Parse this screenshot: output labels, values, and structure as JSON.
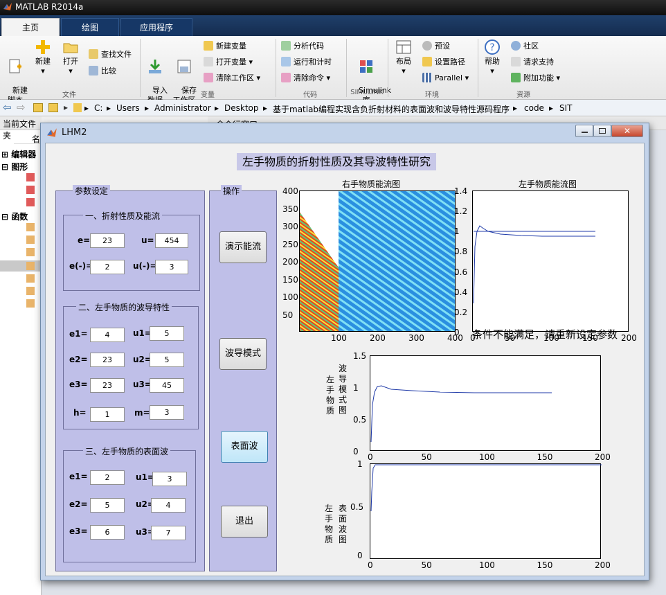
{
  "app": {
    "title": "MATLAB R2014a"
  },
  "tabs": [
    "主页",
    "绘图",
    "应用程序"
  ],
  "ribbon": {
    "new_script": "新建\n脚本",
    "new": "新建",
    "open": "打开",
    "find_files": "查找文件",
    "compare": "比较",
    "import": "导入\n数据",
    "save_ws": "保存\n工作区",
    "new_var": "新建变量",
    "open_var": "打开变量",
    "clear_ws": "清除工作区",
    "analyze": "分析代码",
    "run_time": "运行和计时",
    "clear_cmd": "清除命令",
    "simulink": "Simulink\n库",
    "layout": "布局",
    "prefs": "预设",
    "set_path": "设置路径",
    "parallel": "Parallel",
    "help": "帮助",
    "community": "社区",
    "support": "请求支持",
    "addons": "附加功能",
    "groups": [
      "文件",
      "变量",
      "代码",
      "SIMULINK",
      "环境",
      "资源"
    ]
  },
  "address": {
    "parts": [
      "C:",
      "Users",
      "Administrator",
      "Desktop",
      "基于matlab编程实现含负折射材料的表面波和波导特性源码程序",
      "code",
      "SIT"
    ]
  },
  "left": {
    "header": "当前文件夹",
    "col": "名",
    "items": [
      "编辑器",
      "图形",
      "函数"
    ]
  },
  "cmd_header": "命令行窗口",
  "figure": {
    "title": "LHM2",
    "main_title": "左手物质的折射性质及其导波特性研究",
    "params_title": "参数设定",
    "ops_title": "操作",
    "sec1": {
      "title": "一、折射性质及能流",
      "e_label": "e=",
      "e": "23",
      "u_label": "u=",
      "u": "454",
      "en_label": "e(-)=",
      "en": "2",
      "un_label": "u(-)=",
      "un": "3"
    },
    "sec2": {
      "title": "二、左手物质的波导特性",
      "e1_label": "e1=",
      "e1": "4",
      "u1_label": "u1=",
      "u1": "5",
      "e2_label": "e2=",
      "e2": "23",
      "u2_label": "u2=",
      "u2": "5",
      "e3_label": "e3=",
      "e3": "23",
      "u3_label": "u3=",
      "u3": "45",
      "h_label": "h=",
      "h": "1",
      "m_label": "m=",
      "m": "3"
    },
    "sec3": {
      "title": "三、左手物质的表面波",
      "e1_label": "e1=",
      "e1": "2",
      "u1_label": "u1=",
      "u1": "3",
      "e2_label": "e2=",
      "e2": "5",
      "u2_label": "u2=",
      "u2": "4",
      "e3_label": "e3=",
      "e3": "6",
      "u3_label": "u3=",
      "u3": "7"
    },
    "buttons": {
      "demo": "演示能流",
      "wave": "波导模式",
      "surface": "表面波",
      "exit": "退出"
    },
    "plot1": {
      "title": "右手物质能流图",
      "yticks": [
        "400",
        "350",
        "300",
        "250",
        "200",
        "150",
        "100",
        "50"
      ],
      "xticks": [
        "100",
        "200",
        "300",
        "400"
      ]
    },
    "plot2": {
      "title": "左手物质能流图",
      "yticks": [
        "1.4",
        "1.2",
        "1",
        "0.8",
        "0.6",
        "0.4",
        "0.2",
        "0"
      ],
      "xticks": [
        "0",
        "50",
        "100",
        "150",
        "200"
      ]
    },
    "message": "条件不能满足，请重新设定参数",
    "plot3": {
      "ylabel_a": [
        "左",
        "手",
        "物",
        "质"
      ],
      "ylabel_b": [
        "波",
        "导",
        "模",
        "式",
        "图"
      ],
      "yticks": [
        "1.5",
        "1",
        "0.5",
        "0"
      ],
      "xticks": [
        "0",
        "50",
        "100",
        "150",
        "200"
      ]
    },
    "plot4": {
      "ylabel_a": [
        "左",
        "手",
        "物",
        "质"
      ],
      "ylabel_b": [
        "表",
        "面",
        "波",
        "图"
      ],
      "yticks": [
        "1",
        "0.5",
        "0"
      ],
      "xticks": [
        "0",
        "50",
        "100",
        "150",
        "200"
      ]
    }
  },
  "colors": {
    "accent": "#163766",
    "panel": "#bfbfe8"
  }
}
